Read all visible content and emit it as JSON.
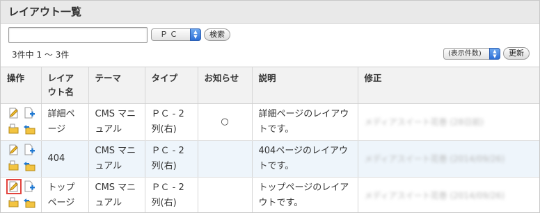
{
  "header": {
    "title": "レイアウト一覧"
  },
  "search": {
    "value": "",
    "device_select": "ＰＣ",
    "search_label": "検索"
  },
  "list_info": {
    "count_text": "3件中 1 ～ 3件",
    "per_page_select": "(表示件数)",
    "refresh_label": "更新"
  },
  "table": {
    "columns": [
      "操作",
      "レイアウト名",
      "テーマ",
      "タイプ",
      "お知らせ",
      "説明",
      "修正"
    ],
    "rows": [
      {
        "name": "詳細ページ",
        "theme": "CMS マニュアル",
        "type": "ＰＣ - 2列(右)",
        "notice": "○",
        "description": "詳細ページのレイアウトです。",
        "modified": "メディアスイート花巻 (28日前)"
      },
      {
        "name": "404",
        "theme": "CMS マニュアル",
        "type": "ＰＣ - 2列(右)",
        "notice": "",
        "description": "404ページのレイアウトです。",
        "modified": "メディアスイート花巻 (2014/09/26)"
      },
      {
        "name": "トップページ",
        "theme": "CMS マニュアル",
        "type": "ＰＣ - 2列(右)",
        "notice": "",
        "description": "トップページのレイアウトです。",
        "modified": "メディアスイート花巻 (2014/09/26)"
      }
    ]
  },
  "icons": {
    "edit": "edit-pencil-icon",
    "copy": "copy-page-icon",
    "move": "move-folder-icon",
    "export": "export-folder-icon"
  },
  "colors": {
    "header_bg": "#e9e9e9",
    "alt_row": "#eef5fb",
    "selected_outline": "#e2433d",
    "select_arrow": "#2d6fd6"
  }
}
